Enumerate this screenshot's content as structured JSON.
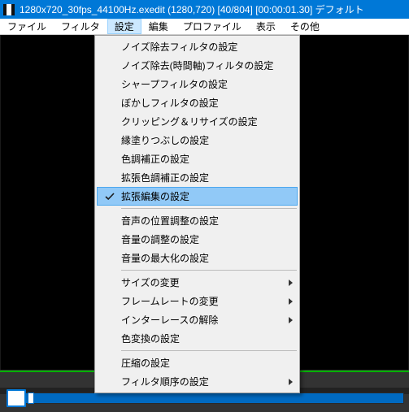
{
  "titlebar": {
    "text": "1280x720_30fps_44100Hz.exedit (1280,720)  [40/804] [00:00:01.30]  デフォルト"
  },
  "menubar": {
    "items": [
      {
        "label": "ファイル"
      },
      {
        "label": "フィルタ"
      },
      {
        "label": "設定"
      },
      {
        "label": "編集"
      },
      {
        "label": "プロファイル"
      },
      {
        "label": "表示"
      },
      {
        "label": "その他"
      }
    ],
    "active_index": 2
  },
  "dropdown": {
    "items": [
      {
        "label": "ノイズ除去フィルタの設定",
        "t": "item"
      },
      {
        "label": "ノイズ除去(時間軸)フィルタの設定",
        "t": "item"
      },
      {
        "label": "シャープフィルタの設定",
        "t": "item"
      },
      {
        "label": "ぼかしフィルタの設定",
        "t": "item"
      },
      {
        "label": "クリッピング＆リサイズの設定",
        "t": "item"
      },
      {
        "label": "縁塗りつぶしの設定",
        "t": "item"
      },
      {
        "label": "色調補正の設定",
        "t": "item"
      },
      {
        "label": "拡張色調補正の設定",
        "t": "item"
      },
      {
        "label": "拡張編集の設定",
        "t": "item",
        "checked": true,
        "highlight": true
      },
      {
        "t": "sep"
      },
      {
        "label": "音声の位置調整の設定",
        "t": "item"
      },
      {
        "label": "音量の調整の設定",
        "t": "item"
      },
      {
        "label": "音量の最大化の設定",
        "t": "item"
      },
      {
        "t": "sep"
      },
      {
        "label": "サイズの変更",
        "t": "item",
        "submenu": true
      },
      {
        "label": "フレームレートの変更",
        "t": "item",
        "submenu": true
      },
      {
        "label": "インターレースの解除",
        "t": "item",
        "submenu": true
      },
      {
        "label": "色変換の設定",
        "t": "item"
      },
      {
        "t": "sep"
      },
      {
        "label": "圧縮の設定",
        "t": "item"
      },
      {
        "label": "フィルタ順序の設定",
        "t": "item",
        "submenu": true
      }
    ]
  },
  "colors": {
    "accent": "#0078d7",
    "highlight": "#91c9f7"
  }
}
